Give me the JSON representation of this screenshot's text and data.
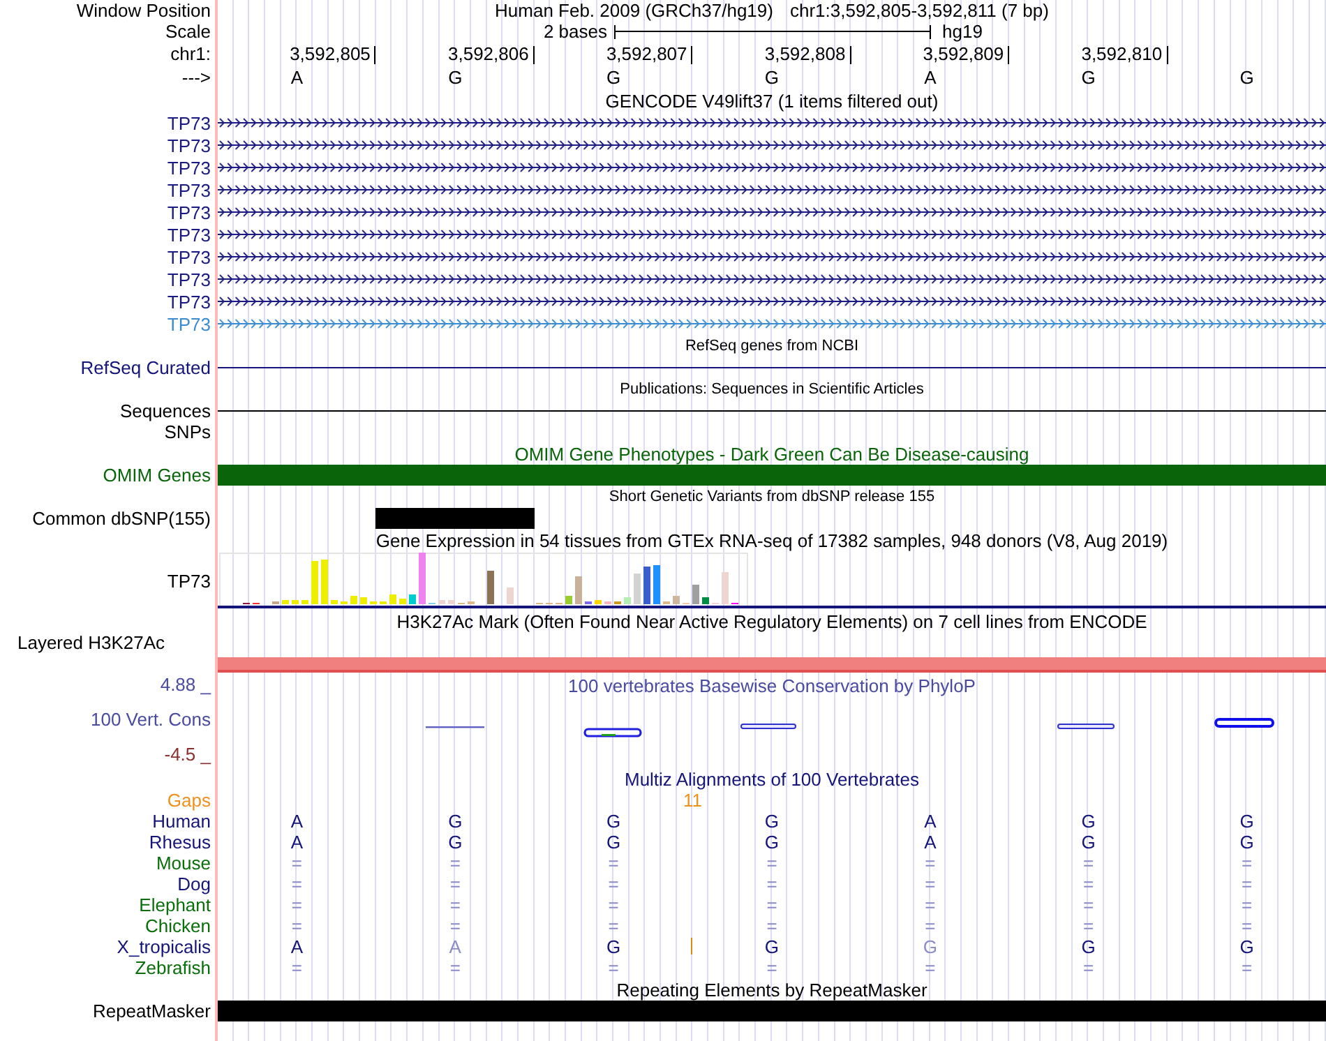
{
  "header": {
    "position_label": "Window Position",
    "assembly": "Human Feb. 2009 (GRCh37/hg19)",
    "position": "chr1:3,592,805-3,592,811 (7 bp)",
    "scale_label": "Scale",
    "scale_text": "2 bases",
    "scale_db": "hg19",
    "ruler_label": "chr1:",
    "ticks": [
      "3,592,805",
      "3,592,806",
      "3,592,807",
      "3,592,808",
      "3,592,809",
      "3,592,810"
    ],
    "strand_label": "--->",
    "bases": [
      "A",
      "G",
      "G",
      "G",
      "A",
      "G",
      "G"
    ]
  },
  "tracks": [
    {
      "kind": "gene",
      "title": "GENCODE V49lift37 (1 items filtered out)",
      "small_title": false,
      "tinted_title": false,
      "rows": [
        {
          "label": "TP73",
          "color": "#1a1a80"
        },
        {
          "label": "TP73",
          "color": "#1a1a80"
        },
        {
          "label": "TP73",
          "color": "#1a1a80"
        },
        {
          "label": "TP73",
          "color": "#1a1a80"
        },
        {
          "label": "TP73",
          "color": "#1a1a80"
        },
        {
          "label": "TP73",
          "color": "#1a1a80"
        },
        {
          "label": "TP73",
          "color": "#1a1a80"
        },
        {
          "label": "TP73",
          "color": "#1a1a80"
        },
        {
          "label": "TP73",
          "color": "#1a1a80"
        },
        {
          "label": "TP73",
          "color": "#3c8cd0"
        }
      ]
    },
    {
      "kind": "line",
      "title": "RefSeq genes from NCBI",
      "small_title": true,
      "tinted_title": false,
      "label": "RefSeq Curated",
      "color": "#14147a"
    },
    {
      "kind": "line",
      "title": "Publications: Sequences in Scientific Articles",
      "small_title": true,
      "tinted_title": false,
      "label": "Sequences",
      "color": "#000000"
    },
    {
      "kind": "empty",
      "label": "SNPs",
      "color": "#000000"
    },
    {
      "kind": "bar",
      "title": "OMIM Gene Phenotypes - Dark Green Can Be Disease-causing",
      "small_title": false,
      "tinted_title": true,
      "label": "OMIM Genes",
      "color": "#0a640a",
      "covered": [
        true,
        true,
        true,
        true,
        true,
        true,
        true
      ]
    },
    {
      "kind": "bar",
      "title": "Short Genetic Variants from dbSNP release 155",
      "small_title": true,
      "tinted_title": false,
      "label": "Common dbSNP(155)",
      "color": "#000000",
      "covered": [
        false,
        true,
        false,
        false,
        false,
        false,
        false
      ]
    },
    {
      "kind": "expression",
      "title": "Gene Expression in 54 tissues from GTEx RNA-seq of 17382 samples, 948 donors (V8, Aug 2019)",
      "small_title": false,
      "tinted_title": false,
      "label": "TP73",
      "color": "#000000"
    },
    {
      "kind": "layered",
      "title": "H3K27Ac Mark (Often Found Near Active Regulatory Elements) on 7 cell lines from ENCODE",
      "small_title": false,
      "tinted_title": false,
      "label": "Layered H3K27Ac",
      "color": "#000000",
      "covered": [
        true,
        true,
        true,
        true,
        true,
        true,
        true
      ]
    },
    {
      "kind": "conservation",
      "title": "100 vertebrates Basewise Conservation by PhyloP",
      "small_title": false,
      "tinted_title": true,
      "upper": "4.88 _",
      "label": "100 Vert. Cons",
      "lower": "-4.5 _",
      "color": "#4a4aa0"
    },
    {
      "kind": "multiz",
      "title": "Multiz Alignments of 100 Vertebrates",
      "small_title": false,
      "tinted_title": true,
      "color": "#14147a",
      "gaps": {
        "label": "Gaps",
        "count": "11"
      },
      "species": [
        {
          "name": "Human",
          "color": "#14147a",
          "cells": [
            {
              "text": "A",
              "faded": false,
              "insertion_after": false
            },
            {
              "text": "G",
              "faded": false,
              "insertion_after": false
            },
            {
              "text": "G",
              "faded": false,
              "insertion_after": false
            },
            {
              "text": "G",
              "faded": false,
              "insertion_after": false
            },
            {
              "text": "A",
              "faded": false,
              "insertion_after": false
            },
            {
              "text": "G",
              "faded": false,
              "insertion_after": false
            },
            {
              "text": "G",
              "faded": false,
              "insertion_after": false
            }
          ]
        },
        {
          "name": "Rhesus",
          "color": "#14147a",
          "cells": [
            {
              "text": "A",
              "faded": false,
              "insertion_after": false
            },
            {
              "text": "G",
              "faded": false,
              "insertion_after": false
            },
            {
              "text": "G",
              "faded": false,
              "insertion_after": false
            },
            {
              "text": "G",
              "faded": false,
              "insertion_after": false
            },
            {
              "text": "A",
              "faded": false,
              "insertion_after": false
            },
            {
              "text": "G",
              "faded": false,
              "insertion_after": false
            },
            {
              "text": "G",
              "faded": false,
              "insertion_after": false
            }
          ]
        },
        {
          "name": "Mouse",
          "color": "#0a6e0a",
          "cells": [
            {
              "text": "=",
              "faded": true,
              "insertion_after": false
            },
            {
              "text": "=",
              "faded": true,
              "insertion_after": false
            },
            {
              "text": "=",
              "faded": true,
              "insertion_after": false
            },
            {
              "text": "=",
              "faded": true,
              "insertion_after": false
            },
            {
              "text": "=",
              "faded": true,
              "insertion_after": false
            },
            {
              "text": "=",
              "faded": true,
              "insertion_after": false
            },
            {
              "text": "=",
              "faded": true,
              "insertion_after": false
            }
          ]
        },
        {
          "name": "Dog",
          "color": "#14147a",
          "cells": [
            {
              "text": "=",
              "faded": true,
              "insertion_after": false
            },
            {
              "text": "=",
              "faded": true,
              "insertion_after": false
            },
            {
              "text": "=",
              "faded": true,
              "insertion_after": false
            },
            {
              "text": "=",
              "faded": true,
              "insertion_after": false
            },
            {
              "text": "=",
              "faded": true,
              "insertion_after": false
            },
            {
              "text": "=",
              "faded": true,
              "insertion_after": false
            },
            {
              "text": "=",
              "faded": true,
              "insertion_after": false
            }
          ]
        },
        {
          "name": "Elephant",
          "color": "#0a6e0a",
          "cells": [
            {
              "text": "=",
              "faded": true,
              "insertion_after": false
            },
            {
              "text": "=",
              "faded": true,
              "insertion_after": false
            },
            {
              "text": "=",
              "faded": true,
              "insertion_after": false
            },
            {
              "text": "=",
              "faded": true,
              "insertion_after": false
            },
            {
              "text": "=",
              "faded": true,
              "insertion_after": false
            },
            {
              "text": "=",
              "faded": true,
              "insertion_after": false
            },
            {
              "text": "=",
              "faded": true,
              "insertion_after": false
            }
          ]
        },
        {
          "name": "Chicken",
          "color": "#0a6e0a",
          "cells": [
            {
              "text": "=",
              "faded": true,
              "insertion_after": false
            },
            {
              "text": "=",
              "faded": true,
              "insertion_after": false
            },
            {
              "text": "=",
              "faded": true,
              "insertion_after": false
            },
            {
              "text": "=",
              "faded": true,
              "insertion_after": false
            },
            {
              "text": "=",
              "faded": true,
              "insertion_after": false
            },
            {
              "text": "=",
              "faded": true,
              "insertion_after": false
            },
            {
              "text": "=",
              "faded": true,
              "insertion_after": false
            }
          ]
        },
        {
          "name": "X_tropicalis",
          "color": "#14147a",
          "cells": [
            {
              "text": "A",
              "faded": false,
              "insertion_after": false
            },
            {
              "text": "A",
              "faded": true,
              "insertion_after": false
            },
            {
              "text": "G",
              "faded": false,
              "insertion_after": true
            },
            {
              "text": "G",
              "faded": false,
              "insertion_after": false
            },
            {
              "text": "G",
              "faded": true,
              "insertion_after": false
            },
            {
              "text": "G",
              "faded": false,
              "insertion_after": false
            },
            {
              "text": "G",
              "faded": false,
              "insertion_after": false
            }
          ]
        },
        {
          "name": "Zebrafish",
          "color": "#0a6e0a",
          "cells": [
            {
              "text": "=",
              "faded": true,
              "insertion_after": false
            },
            {
              "text": "=",
              "faded": true,
              "insertion_after": false
            },
            {
              "text": "=",
              "faded": true,
              "insertion_after": false
            },
            {
              "text": "=",
              "faded": true,
              "insertion_after": false
            },
            {
              "text": "=",
              "faded": true,
              "insertion_after": false
            },
            {
              "text": "=",
              "faded": true,
              "insertion_after": false
            },
            {
              "text": "=",
              "faded": true,
              "insertion_after": false
            }
          ]
        }
      ]
    },
    {
      "kind": "bar",
      "title": "Repeating Elements by RepeatMasker",
      "small_title": false,
      "tinted_title": false,
      "label": "RepeatMasker",
      "color": "#000000",
      "covered": [
        true,
        true,
        true,
        true,
        true,
        true,
        true
      ]
    }
  ]
}
